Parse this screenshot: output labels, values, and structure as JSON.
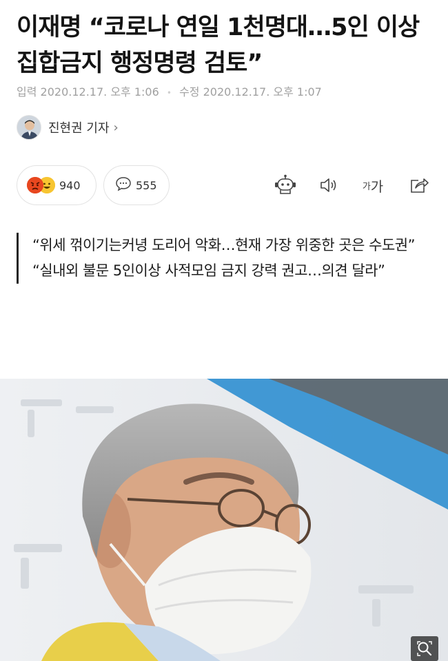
{
  "article": {
    "headline": "이재명 “코로나 연일 1천명대…5인 이상 집합금지 행정명령 검토”",
    "published_label": "입력",
    "published_at": "2020.12.17. 오후 1:06",
    "separator": "•",
    "modified_label": "수정",
    "modified_at": "2020.12.17. 오후 1:07"
  },
  "author": {
    "name": "진현권 기자",
    "chevron": "›"
  },
  "reactions": {
    "reaction_count": "940",
    "comment_count": "555",
    "icons": [
      "angry-emoji",
      "smile-emoji",
      "comment-bubble-icon"
    ]
  },
  "toolbar": {
    "font_label_small": "가",
    "font_label_large": "가",
    "icons": [
      "robot-read-icon",
      "speaker-icon",
      "font-size-icon",
      "share-icon"
    ]
  },
  "summary": {
    "lines": [
      "“위세 꺾이기는커녕 도리어 악화…현재 가장 위중한 곳은 수도권”",
      "“실내외 불문 5인이상 사적모임 금지 강력 권고…의견 달라”"
    ]
  },
  "photo": {
    "zoom_icon": "zoom-icon",
    "colors": {
      "banner_blue": "#2f8fd0",
      "wall": "#f1f2f4",
      "vest": "#e8cf4a"
    }
  }
}
